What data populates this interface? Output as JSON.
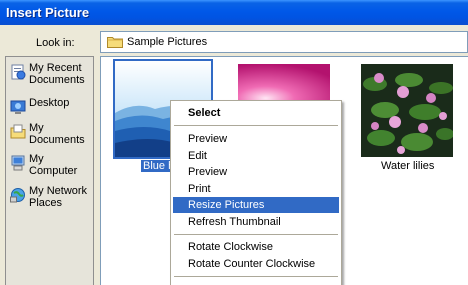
{
  "window": {
    "title": "Insert Picture"
  },
  "lookin": {
    "label": "Look in:",
    "value": "Sample Pictures",
    "icon": "folder-icon"
  },
  "places": [
    {
      "label": "My Recent Documents",
      "icon": "recent-documents-icon"
    },
    {
      "label": "Desktop",
      "icon": "desktop-icon"
    },
    {
      "label": "My Documents",
      "icon": "my-documents-icon"
    },
    {
      "label": "My Computer",
      "icon": "my-computer-icon"
    },
    {
      "label": "My Network Places",
      "icon": "network-places-icon"
    }
  ],
  "files": [
    {
      "caption": "Blue h",
      "selected": true
    },
    {
      "caption": "",
      "selected": false
    },
    {
      "caption": "Water lilies",
      "selected": false
    }
  ],
  "context_menu": {
    "items": [
      {
        "label": "Select",
        "bold": true
      },
      {
        "label": "Preview"
      },
      {
        "label": "Edit"
      },
      {
        "label": "Preview"
      },
      {
        "label": "Print"
      },
      {
        "label": "Resize Pictures",
        "highlighted": true
      },
      {
        "label": "Refresh Thumbnail"
      },
      {
        "label": "Rotate Clockwise"
      },
      {
        "label": "Rotate Counter Clockwise"
      }
    ]
  },
  "colors": {
    "titlebar": "#0054e3",
    "selection": "#316ac5"
  }
}
